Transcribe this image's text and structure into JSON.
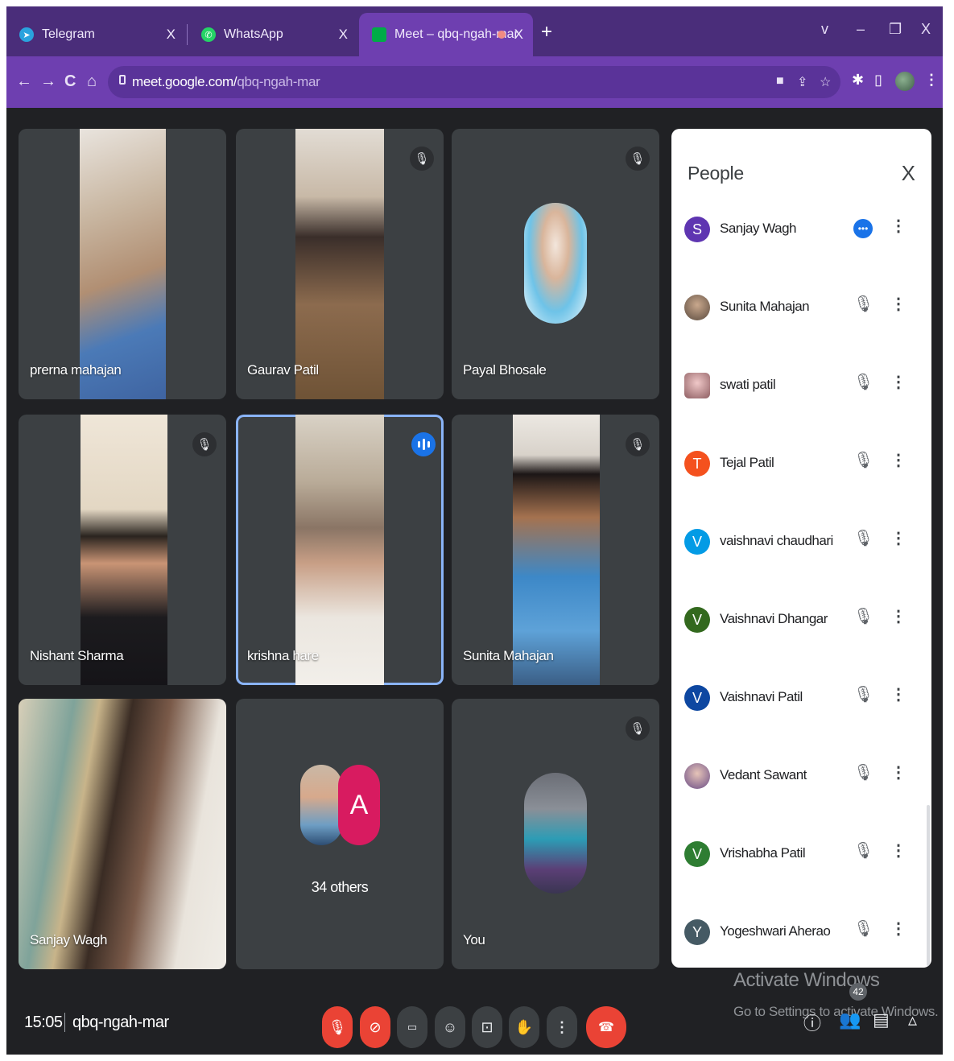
{
  "browser": {
    "tabs": [
      {
        "label": "Telegram",
        "color": "#2aa3de"
      },
      {
        "label": "WhatsApp",
        "color": "#25d366"
      },
      {
        "label": "Meet – qbq-ngah-mar",
        "color": "#00ac47"
      }
    ],
    "url_host": "meet.google.com/",
    "url_path": "qbq-ngah-mar"
  },
  "tiles": [
    {
      "name": "prerna mahajan"
    },
    {
      "name": "Gaurav Patil"
    },
    {
      "name": "Payal Bhosale"
    },
    {
      "name": "Nishant Sharma"
    },
    {
      "name": "krishna hare"
    },
    {
      "name": "Sunita Mahajan"
    },
    {
      "name": "Sanjay Wagh"
    },
    {
      "others": "34 others",
      "avatar_letter": "A"
    },
    {
      "name": "You"
    }
  ],
  "people_panel": {
    "title": "People",
    "close_icon": "close-icon",
    "people": [
      {
        "name": "Sanjay Wagh",
        "initial": "S",
        "color": "#5e35b1",
        "speaking": true
      },
      {
        "name": "Sunita Mahajan",
        "initial": "",
        "color": "#7a6a5a",
        "speaking": false
      },
      {
        "name": "swati patil",
        "initial": "",
        "color": "#b77c86",
        "speaking": false
      },
      {
        "name": "Tejal Patil",
        "initial": "T",
        "color": "#f4511e",
        "speaking": false
      },
      {
        "name": "vaishnavi chaudhari",
        "initial": "V",
        "color": "#039be5",
        "speaking": false
      },
      {
        "name": "Vaishnavi Dhangar",
        "initial": "V",
        "color": "#33691e",
        "speaking": false
      },
      {
        "name": "Vaishnavi Patil",
        "initial": "V",
        "color": "#0d47a1",
        "speaking": false
      },
      {
        "name": "Vedant Sawant",
        "initial": "",
        "color": "#8d6e9e",
        "speaking": false
      },
      {
        "name": "Vrishabha Patil",
        "initial": "V",
        "color": "#2e7d32",
        "speaking": false
      },
      {
        "name": "Yogeshwari Aherao",
        "initial": "Y",
        "color": "#455a64",
        "speaking": false
      }
    ]
  },
  "meeting": {
    "time": "15:05",
    "code": "qbq-ngah-mar",
    "participant_count": "42"
  },
  "watermark": {
    "title": "Activate Windows",
    "subtitle": "Go to Settings to activate Windows."
  }
}
